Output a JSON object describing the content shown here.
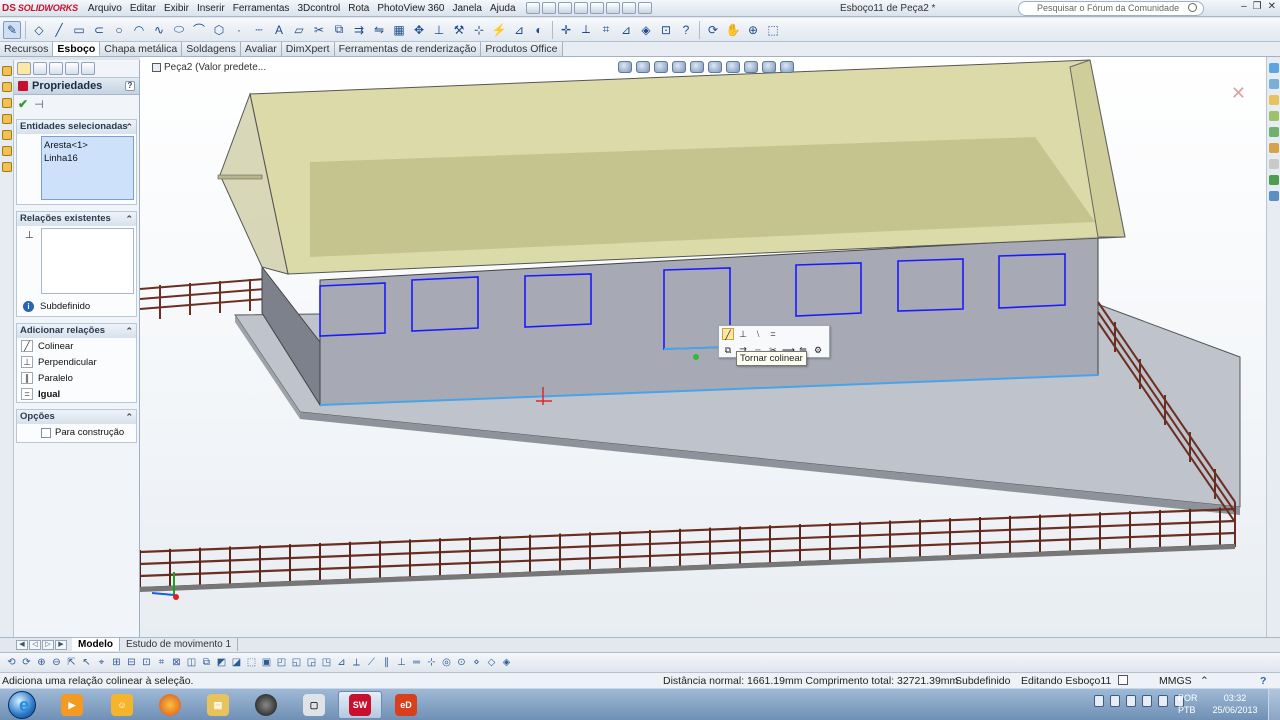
{
  "titlebar": {
    "brand_ds": "DS",
    "brand_sw": "SOLIDWORKS",
    "menus": [
      "Arquivo",
      "Editar",
      "Exibir",
      "Inserir",
      "Ferramentas",
      "3Dcontrol",
      "Rota",
      "PhotoView 360",
      "Janela",
      "Ajuda"
    ],
    "document_title": "Esboço11 de Peça2 *",
    "search_placeholder": "Pesquisar o Fórum da Comunidade"
  },
  "tabs": {
    "items": [
      "Recursos",
      "Esboço",
      "Chapa metálica",
      "Soldagens",
      "Avaliar",
      "DimXpert",
      "Ferramentas de renderização",
      "Produtos Office"
    ],
    "active": "Esboço"
  },
  "property_manager": {
    "title": "Propriedades",
    "selected_entities": {
      "title": "Entidades selecionadas",
      "items": [
        "Aresta<1>",
        "Linha16"
      ]
    },
    "existing_relations": {
      "title": "Relações existentes",
      "status": "Subdefinido"
    },
    "add_relations": {
      "title": "Adicionar relações",
      "items": [
        {
          "label": "Colinear",
          "icon": "collinear-icon",
          "bold": false
        },
        {
          "label": "Perpendicular",
          "icon": "perpendicular-icon",
          "bold": false
        },
        {
          "label": "Paralelo",
          "icon": "parallel-icon",
          "bold": false
        },
        {
          "label": "Igual",
          "icon": "equal-icon",
          "bold": true
        }
      ]
    },
    "options": {
      "title": "Opções",
      "for_construction": "Para construção"
    }
  },
  "viewport": {
    "breadcrumb": "Peça2  (Valor predete...",
    "tooltip": "Tornar colinear"
  },
  "bottom_tabs": {
    "items": [
      "Modelo",
      "Estudo de movimento 1"
    ],
    "active": "Modelo"
  },
  "statusbar": {
    "hint": "Adiciona uma relação colinear à seleção.",
    "measure": "Distância normal: 1661.19mm Comprimento total: 32721.39mm",
    "state": "Subdefinido",
    "editing": "Editando Esboço11",
    "units": "MMGS"
  },
  "taskbar": {
    "language": "POR",
    "language_sub": "PTB",
    "time": "03:32",
    "date": "25/06/2013",
    "apps": [
      "ie-icon",
      "media-player-icon",
      "messenger-icon",
      "firefox-icon",
      "explorer-icon",
      "camera-icon",
      "studio-icon",
      "solidworks-icon",
      "edrawings-icon"
    ]
  },
  "colors": {
    "roof": "#d6d49a",
    "wall": "#a7aab4",
    "sketch": "#1a1aff",
    "fence": "#6b2f22",
    "accent": "#c8102e"
  }
}
